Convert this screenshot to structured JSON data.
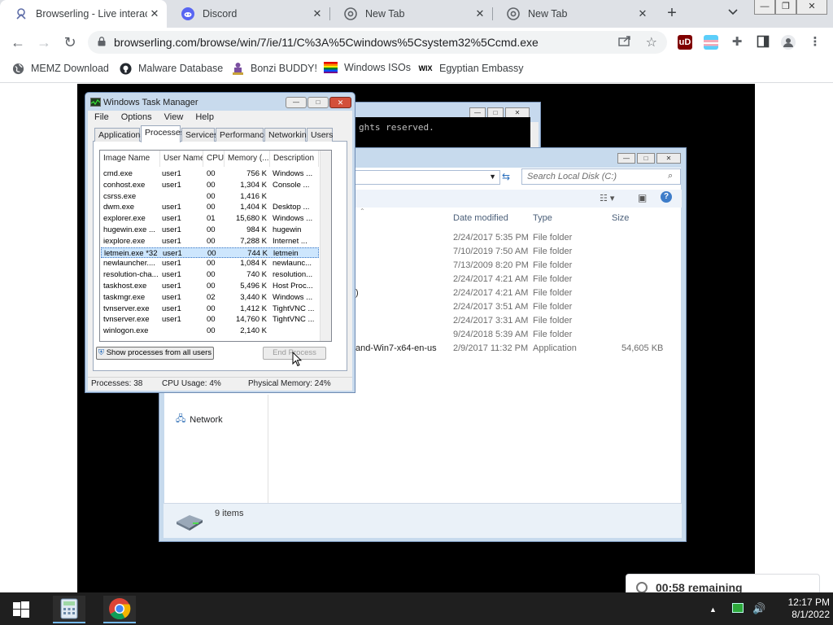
{
  "browser": {
    "tabs": [
      {
        "title": "Browserling - Live interac",
        "icon": "browserling-icon",
        "active": true
      },
      {
        "title": "Discord",
        "icon": "discord-icon",
        "active": false
      },
      {
        "title": "New Tab",
        "icon": "chrome-icon",
        "active": false
      },
      {
        "title": "New Tab",
        "icon": "chrome-icon",
        "active": false
      }
    ],
    "new_tab_label": "+",
    "url": "browserling.com/browse/win/7/ie/11/C%3A%5Cwindows%5Csystem32%5Ccmd.exe",
    "bookmarks": [
      {
        "label": "MEMZ Download",
        "icon": "globe-icon"
      },
      {
        "label": "Malware Database",
        "icon": "github-icon"
      },
      {
        "label": "Bonzi BUDDY!",
        "icon": "bonzi-icon"
      },
      {
        "label": "Windows ISOs",
        "icon": "rainbow-flag-icon"
      },
      {
        "label": "Egyptian Embassy",
        "icon": "wix-icon",
        "icon_text": "WIX"
      }
    ]
  },
  "console": {
    "text": "ghts reserved."
  },
  "explorer": {
    "search_placeholder": "Search Local Disk (C:)",
    "columns": {
      "date": "Date modified",
      "type": "Type",
      "size": "Size"
    },
    "rows": [
      {
        "name": "",
        "date": "2/24/2017 5:35 PM",
        "type": "File folder",
        "size": ""
      },
      {
        "name": "",
        "date": "7/10/2019 7:50 AM",
        "type": "File folder",
        "size": ""
      },
      {
        "name": "",
        "date": "7/13/2009 8:20 PM",
        "type": "File folder",
        "size": ""
      },
      {
        "name": "",
        "date": "2/24/2017 4:21 AM",
        "type": "File folder",
        "size": ""
      },
      {
        "name": ")",
        "date": "2/24/2017 4:21 AM",
        "type": "File folder",
        "size": ""
      },
      {
        "name": "",
        "date": "2/24/2017 3:51 AM",
        "type": "File folder",
        "size": ""
      },
      {
        "name": "",
        "date": "2/24/2017 3:31 AM",
        "type": "File folder",
        "size": ""
      },
      {
        "name": "",
        "date": "9/24/2018 5:39 AM",
        "type": "File folder",
        "size": ""
      },
      {
        "name": "and-Win7-x64-en-us",
        "date": "2/9/2017 11:32 PM",
        "type": "Application",
        "size": "54,605 KB"
      }
    ],
    "nav_network": "Network",
    "status_items": "9 items"
  },
  "taskmgr": {
    "title": "Windows Task Manager",
    "menu": [
      "File",
      "Options",
      "View",
      "Help"
    ],
    "tabs": [
      "Applications",
      "Processes",
      "Services",
      "Performance",
      "Networking",
      "Users"
    ],
    "active_tab": "Processes",
    "columns": [
      "Image Name",
      "User Name",
      "CPU",
      "Memory (...",
      "Description"
    ],
    "processes": [
      {
        "name": "cmd.exe",
        "user": "user1",
        "cpu": "00",
        "mem": "756 K",
        "desc": "Windows ..."
      },
      {
        "name": "conhost.exe",
        "user": "user1",
        "cpu": "00",
        "mem": "1,304 K",
        "desc": "Console ..."
      },
      {
        "name": "csrss.exe",
        "user": "",
        "cpu": "00",
        "mem": "1,416 K",
        "desc": ""
      },
      {
        "name": "dwm.exe",
        "user": "user1",
        "cpu": "00",
        "mem": "1,404 K",
        "desc": "Desktop ..."
      },
      {
        "name": "explorer.exe",
        "user": "user1",
        "cpu": "01",
        "mem": "15,680 K",
        "desc": "Windows ..."
      },
      {
        "name": "hugewin.exe ...",
        "user": "user1",
        "cpu": "00",
        "mem": "984 K",
        "desc": "hugewin"
      },
      {
        "name": "iexplore.exe",
        "user": "user1",
        "cpu": "00",
        "mem": "7,288 K",
        "desc": "Internet ..."
      },
      {
        "name": "letmein.exe *32",
        "user": "user1",
        "cpu": "00",
        "mem": "744 K",
        "desc": "letmein",
        "selected": true
      },
      {
        "name": "newlauncher....",
        "user": "user1",
        "cpu": "00",
        "mem": "1,084 K",
        "desc": "newlaunc..."
      },
      {
        "name": "resolution-cha...",
        "user": "user1",
        "cpu": "00",
        "mem": "740 K",
        "desc": "resolution..."
      },
      {
        "name": "taskhost.exe",
        "user": "user1",
        "cpu": "00",
        "mem": "5,496 K",
        "desc": "Host Proc..."
      },
      {
        "name": "taskmgr.exe",
        "user": "user1",
        "cpu": "02",
        "mem": "3,440 K",
        "desc": "Windows ..."
      },
      {
        "name": "tvnserver.exe",
        "user": "user1",
        "cpu": "00",
        "mem": "1,412 K",
        "desc": "TightVNC ..."
      },
      {
        "name": "tvnserver.exe",
        "user": "user1",
        "cpu": "00",
        "mem": "14,760 K",
        "desc": "TightVNC ..."
      },
      {
        "name": "winlogon.exe",
        "user": "",
        "cpu": "00",
        "mem": "2,140 K",
        "desc": ""
      }
    ],
    "show_all_label": "Show processes from all users",
    "end_process_label": "End Process",
    "status": {
      "processes": "Processes: 38",
      "cpu": "CPU Usage: 4%",
      "memory": "Physical Memory: 24%"
    }
  },
  "timer": {
    "text": "00:58 remaining"
  },
  "taskbar": {
    "time": "12:17 PM",
    "date": "8/1/2022"
  }
}
